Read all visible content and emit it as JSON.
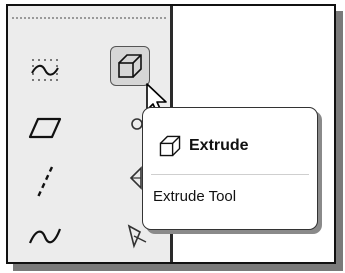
{
  "toolbar": {
    "tools": [
      {
        "icon": "smooth-curve-dotted-icon"
      },
      {
        "icon": "extrude-icon",
        "state": "hovered"
      },
      {
        "icon": "parallelogram-icon"
      },
      {
        "icon": "dashed-line-icon"
      },
      {
        "icon": "spline-icon"
      }
    ]
  },
  "tooltip": {
    "title": "Extrude",
    "description": "Extrude Tool",
    "icon": "extrude-icon"
  },
  "colors": {
    "panel_bg": "#ececec",
    "hover_bg": "#d6d6d6",
    "tooltip_bg": "#ffffff",
    "text": "#111111"
  }
}
